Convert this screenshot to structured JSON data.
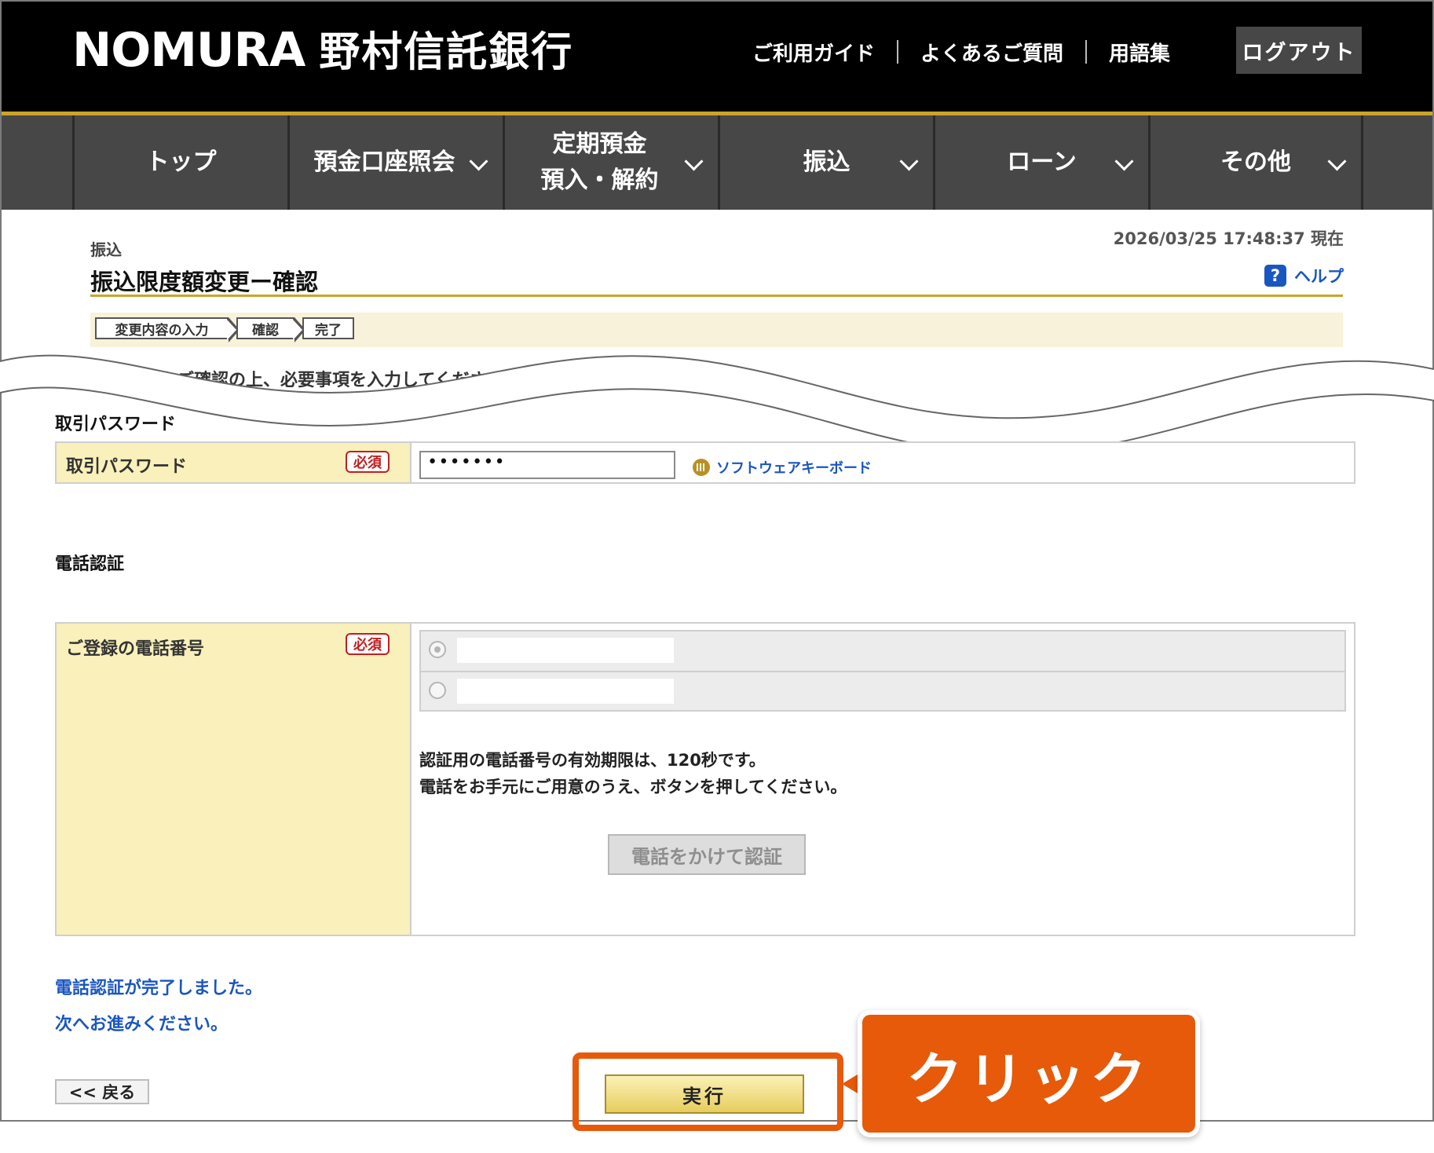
{
  "header": {
    "logo_en": "NOMURA",
    "logo_jp": "野村信託銀行",
    "util_links": [
      "ご利用ガイド",
      "よくあるご質問",
      "用語集"
    ],
    "logout_label": "ログアウト"
  },
  "nav": {
    "items": [
      {
        "label": "トップ"
      },
      {
        "label": "預金口座照会"
      },
      {
        "label": "定期預金",
        "label2": "預入・解約"
      },
      {
        "label": "振込"
      },
      {
        "label": "ローン"
      },
      {
        "label": "その他"
      }
    ]
  },
  "page": {
    "breadcrumb": "振込",
    "title": "振込限度額変更ー確認",
    "timestamp": "2026/03/25 17:48:37 現在",
    "help_icon": "?",
    "help_label": "ヘルプ",
    "steps": [
      "変更内容の入力",
      "確認",
      "完了"
    ],
    "instruction": "変更内容をご確認の上、必要事項を入力してください。"
  },
  "password_section": {
    "heading": "取引パスワード",
    "label": "取引パスワード",
    "required": "必須",
    "value": "•••••••",
    "keyboard_label": "ソフトウェアキーボード"
  },
  "phone_section": {
    "heading": "電話認証",
    "label": "ご登録の電話番号",
    "required": "必須",
    "note1": "認証用の電話番号の有効期限は、120秒です。",
    "note2": "電話をお手元にご用意のうえ、ボタンを押してください。",
    "call_button": "電話をかけて認証",
    "done1": "電話認証が完了しました。",
    "done2": "次へお進みください。"
  },
  "actions": {
    "back": "<< 戻る",
    "execute": "実行"
  },
  "annotation": {
    "callout": "クリック",
    "color": "#e65a0a"
  }
}
